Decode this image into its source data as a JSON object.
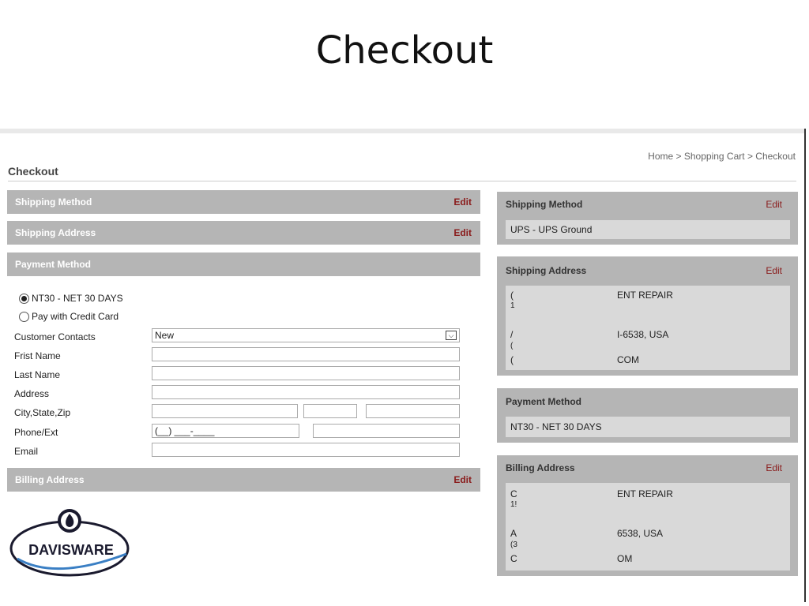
{
  "slide_title": "Checkout",
  "breadcrumb": {
    "home": "Home",
    "cart": "Shopping Cart",
    "current": "Checkout",
    "sep": ">"
  },
  "page_heading": "Checkout",
  "left": {
    "shipping_method": {
      "title": "Shipping Method",
      "edit": "Edit"
    },
    "shipping_address": {
      "title": "Shipping Address",
      "edit": "Edit"
    },
    "payment_method": {
      "title": "Payment Method"
    },
    "payment_options": [
      "NT30 - NET 30 DAYS",
      "Pay with Credit Card"
    ],
    "selected_payment": "NT30 - NET 30 DAYS",
    "form": {
      "customer_contacts_label": "Customer Contacts",
      "customer_contacts_value": "New",
      "first_name_label": "Frist Name",
      "last_name_label": "Last Name",
      "address_label": "Address",
      "city_state_zip_label": "City,State,Zip",
      "phone_label": "Phone/Ext",
      "phone_mask": "(__) ___-____",
      "email_label": "Email"
    },
    "billing_address": {
      "title": "Billing Address",
      "edit": "Edit"
    }
  },
  "right": {
    "shipping_method": {
      "title": "Shipping Method",
      "edit": "Edit",
      "value": "UPS - UPS Ground"
    },
    "shipping_address": {
      "title": "Shipping Address",
      "edit": "Edit",
      "lines_a": [
        "(",
        "1",
        "",
        "/",
        "(",
        "("
      ],
      "lines_b": [
        "ENT REPAIR",
        "",
        "",
        "I-6538, USA",
        "",
        "COM"
      ]
    },
    "payment_method": {
      "title": "Payment Method",
      "value": "NT30 - NET 30 DAYS"
    },
    "billing_address": {
      "title": "Billing Address",
      "edit": "Edit",
      "lines_a": [
        "C",
        "1!",
        "",
        "A",
        "(3",
        "C"
      ],
      "lines_b": [
        "ENT REPAIR",
        "",
        "",
        "6538, USA",
        "",
        "OM"
      ]
    }
  },
  "logo": {
    "text": "DAVISWARE"
  },
  "colors": {
    "bar_bg": "#b5b5b5",
    "edit_text": "#8a1c1c",
    "panel_inner": "#d9d9d9"
  }
}
